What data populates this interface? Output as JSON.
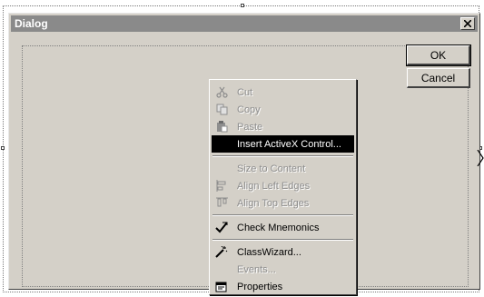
{
  "dialog": {
    "title": "Dialog",
    "close_glyph": "×",
    "ok_label": "OK",
    "cancel_label": "Cancel"
  },
  "context_menu": {
    "items": [
      {
        "label": "Cut",
        "icon": "scissors-icon",
        "enabled": false
      },
      {
        "label": "Copy",
        "icon": "copy-icon",
        "enabled": false
      },
      {
        "label": "Paste",
        "icon": "clipboard-icon",
        "enabled": false
      },
      {
        "label": "Insert ActiveX Control...",
        "icon": "",
        "enabled": true,
        "highlighted": true
      },
      {
        "label": "Size to Content",
        "icon": "",
        "enabled": false
      },
      {
        "label": "Align Left Edges",
        "icon": "align-left-icon",
        "enabled": false
      },
      {
        "label": "Align Top Edges",
        "icon": "align-top-icon",
        "enabled": false
      },
      {
        "label": "Check Mnemonics",
        "icon": "checkmark-icon",
        "enabled": true
      },
      {
        "label": "ClassWizard...",
        "icon": "wand-icon",
        "enabled": true
      },
      {
        "label": "Events...",
        "icon": "",
        "enabled": false
      },
      {
        "label": "Properties",
        "icon": "properties-icon",
        "enabled": true
      }
    ]
  },
  "colors": {
    "titlebar_bg": "#8a8a8a",
    "face": "#d4d0c8",
    "highlight": "#000000",
    "disabled_text": "#8e8e8e"
  }
}
